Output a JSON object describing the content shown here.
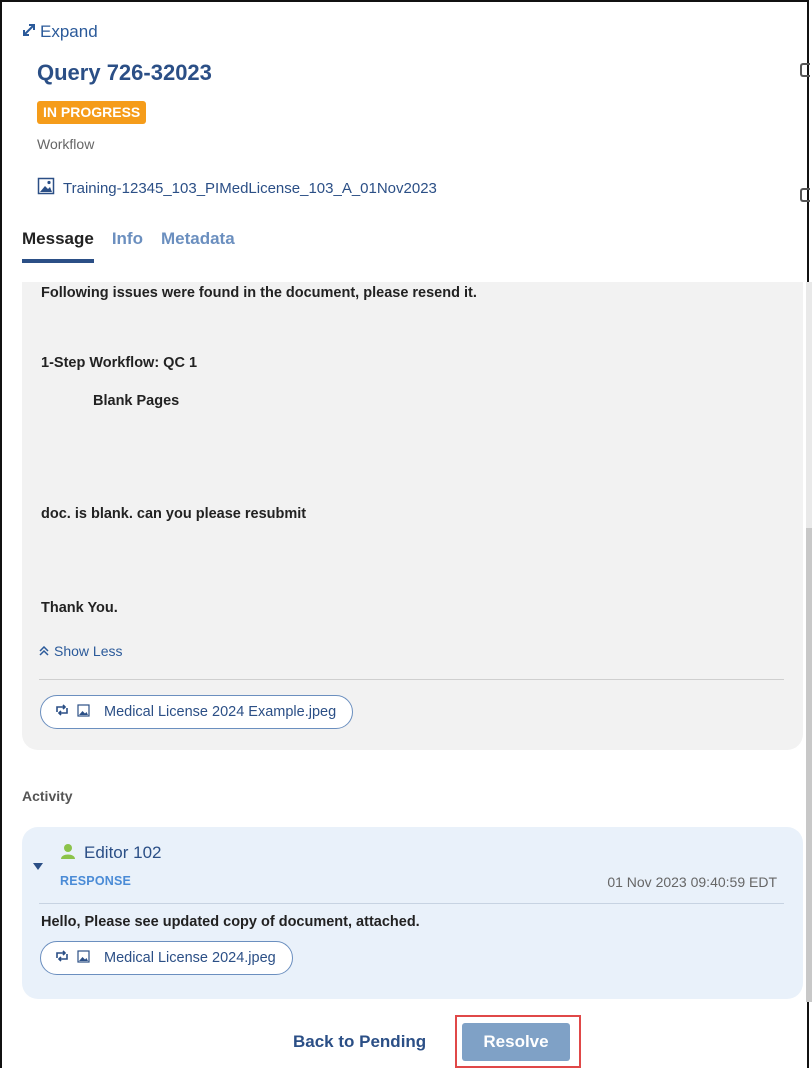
{
  "header": {
    "expand_label": "Expand",
    "title": "Query 726-32023",
    "status": "IN PROGRESS",
    "type": "Workflow",
    "document_name": "Training-12345_103_PIMedLicense_103_A_01Nov2023"
  },
  "tabs": [
    {
      "label": "Message",
      "active": true
    },
    {
      "label": "Info",
      "active": false
    },
    {
      "label": "Metadata",
      "active": false
    }
  ],
  "message": {
    "lines": [
      "Following issues were found in the document, please resend it.",
      "1-Step Workflow: QC 1",
      "Blank Pages",
      "doc. is blank. can you please resubmit",
      "Thank You."
    ],
    "show_less_label": "Show Less",
    "attachment": "Medical License 2024 Example.jpeg"
  },
  "activity": {
    "label": "Activity",
    "entries": [
      {
        "author": "Editor 102",
        "kind": "RESPONSE",
        "timestamp": "01 Nov 2023 09:40:59 EDT",
        "text": "Hello, Please see updated copy of document, attached.",
        "attachment": "Medical License 2024.jpeg"
      }
    ]
  },
  "footer": {
    "back_label": "Back to Pending",
    "resolve_label": "Resolve"
  },
  "colors": {
    "accent": "#2b4f86",
    "status_badge": "#f59c1a",
    "resolve_button": "#7fa1c6",
    "highlight_border": "#e04848",
    "person_icon": "#8bc34a"
  },
  "icons": [
    "expand-icon",
    "image-file-icon",
    "double-chevron-up-icon",
    "retweet-icon",
    "person-icon",
    "caret-down-icon"
  ]
}
